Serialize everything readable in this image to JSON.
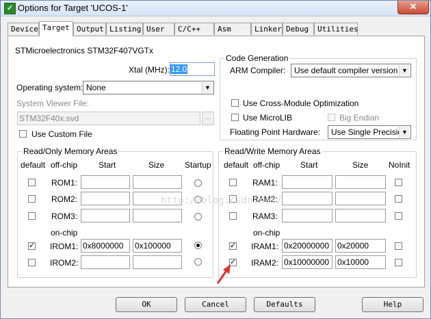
{
  "window": {
    "title": "Options for Target 'UCOS-1'",
    "close_label": "✕",
    "app_icon": "uv-icon"
  },
  "tabs": [
    "Device",
    "Target",
    "Output",
    "Listing",
    "User",
    "C/C++",
    "Asm",
    "Linker",
    "Debug",
    "Utilities"
  ],
  "active_tab": "Target",
  "device_name": "STMicroelectronics STM32F407VGTx",
  "xtal": {
    "label": "Xtal (MHz):",
    "value": "12.0"
  },
  "os": {
    "label": "Operating system:",
    "value": "None"
  },
  "svd": {
    "label": "System Viewer File:",
    "value": "STM32F40x.svd",
    "browse": "..."
  },
  "custom_file": {
    "label": "Use Custom File",
    "checked": false
  },
  "codegen": {
    "title": "Code Generation",
    "compiler_label": "ARM Compiler:",
    "compiler_value": "Use default compiler version",
    "cross_module": "Use Cross-Module Optimization",
    "microlib": "Use MicroLIB",
    "big_endian": "Big Endian",
    "fp_label": "Floating Point Hardware:",
    "fp_value": "Use Single Precision"
  },
  "rom_area": {
    "title": "Read/Only Memory Areas",
    "headers": {
      "default": "default",
      "offchip": "off-chip",
      "start": "Start",
      "size": "Size",
      "startup": "Startup"
    },
    "onchip_label": "on-chip",
    "rows": [
      {
        "name": "ROM1:",
        "default": false,
        "start": "",
        "size": "",
        "startup": false
      },
      {
        "name": "ROM2:",
        "default": false,
        "start": "",
        "size": "",
        "startup": false
      },
      {
        "name": "ROM3:",
        "default": false,
        "start": "",
        "size": "",
        "startup": false
      },
      {
        "name": "IROM1:",
        "default": true,
        "start": "0x8000000",
        "size": "0x100000",
        "startup": true
      },
      {
        "name": "IROM2:",
        "default": false,
        "start": "",
        "size": "",
        "startup": false
      }
    ]
  },
  "ram_area": {
    "title": "Read/Write Memory Areas",
    "headers": {
      "default": "default",
      "offchip": "off-chip",
      "start": "Start",
      "size": "Size",
      "noinit": "NoInit"
    },
    "onchip_label": "on-chip",
    "rows": [
      {
        "name": "RAM1:",
        "default": false,
        "start": "",
        "size": "",
        "noinit": false
      },
      {
        "name": "RAM2:",
        "default": false,
        "start": "",
        "size": "",
        "noinit": false
      },
      {
        "name": "RAM3:",
        "default": false,
        "start": "",
        "size": "",
        "noinit": false
      },
      {
        "name": "IRAM1:",
        "default": true,
        "start": "0x20000000",
        "size": "0x20000",
        "noinit": false
      },
      {
        "name": "IRAM2:",
        "default": true,
        "start": "0x10000000",
        "size": "0x10000",
        "noinit": false
      }
    ]
  },
  "buttons": {
    "ok": "OK",
    "cancel": "Cancel",
    "defaults": "Defaults",
    "help": "Help"
  },
  "watermark": "http://blog.csdn.net/",
  "colors": {
    "arrow": "#e0302a",
    "selection": "#3399ff"
  }
}
